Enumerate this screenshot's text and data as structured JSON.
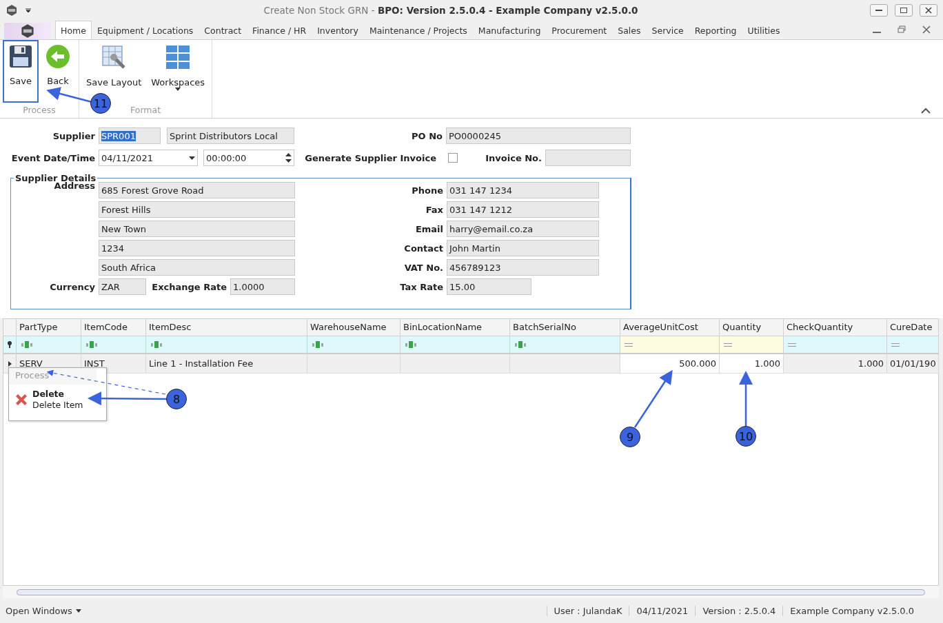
{
  "window": {
    "title": "Create Non Stock GRN - **BPO: Version 2.5.0.4 - Example Company v2.5.0.0**"
  },
  "tabs": [
    {
      "label": "Home",
      "selected": true
    },
    {
      "label": "Equipment / Locations",
      "selected": false
    },
    {
      "label": "Contract",
      "selected": false
    },
    {
      "label": "Finance / HR",
      "selected": false
    },
    {
      "label": "Inventory",
      "selected": false
    },
    {
      "label": "Maintenance / Projects",
      "selected": false
    },
    {
      "label": "Manufacturing",
      "selected": false
    },
    {
      "label": "Procurement",
      "selected": false
    },
    {
      "label": "Sales",
      "selected": false
    },
    {
      "label": "Service",
      "selected": false
    },
    {
      "label": "Reporting",
      "selected": false
    },
    {
      "label": "Utilities",
      "selected": false
    }
  ],
  "ribbon": {
    "groups": [
      {
        "label": "Process",
        "buttons": [
          {
            "label": "Save",
            "kind": "save",
            "highlighted": true
          },
          {
            "label": "Back",
            "kind": "back",
            "highlighted": false
          }
        ]
      },
      {
        "label": "Format",
        "buttons": [
          {
            "label": "Save Layout",
            "kind": "layout",
            "highlighted": false
          },
          {
            "label": "Workspaces",
            "kind": "tiles",
            "highlighted": false,
            "dropdown": true
          }
        ]
      }
    ]
  },
  "form": {
    "supplier": {
      "label": "Supplier",
      "code": "SPR001",
      "name": "Sprint Distributors Local"
    },
    "po": {
      "label": "PO No",
      "value": "PO0000245"
    },
    "event": {
      "label": "Event Date/Time",
      "date": "04/11/2021",
      "time": "00:00:00"
    },
    "generate_invoice": {
      "label": "Generate Supplier Invoice",
      "checked": false
    },
    "invoice_no": {
      "label": "Invoice No."
    }
  },
  "supplier_details": {
    "title": "Supplier Details",
    "address_label": "Address",
    "address_lines": [
      "685 Forest Grove Road",
      "Forest Hills",
      "New Town",
      "1234",
      "South Africa"
    ],
    "contacts": [
      {
        "label": "Phone",
        "value": "031 147 1234"
      },
      {
        "label": "Fax",
        "value": "031 147 1212"
      },
      {
        "label": "Email",
        "value": "harry@email.co.za"
      },
      {
        "label": "Contact",
        "value": "John Martin"
      },
      {
        "label": "VAT No.",
        "value": "456789123"
      }
    ],
    "currency": {
      "label": "Currency",
      "value": "ZAR"
    },
    "exchange_rate": {
      "label": "Exchange Rate",
      "value": "1.0000"
    },
    "tax_rate": {
      "label": "Tax Rate",
      "value": "15.00"
    }
  },
  "grid": {
    "columns": [
      {
        "label": "PartType",
        "kind": "text",
        "editable": false
      },
      {
        "label": "ItemCode",
        "kind": "text",
        "editable": false
      },
      {
        "label": "ItemDesc",
        "kind": "text",
        "editable": false
      },
      {
        "label": "WarehouseName",
        "kind": "text",
        "editable": false
      },
      {
        "label": "BinLocationName",
        "kind": "text",
        "editable": false
      },
      {
        "label": "BatchSerialNo",
        "kind": "text",
        "editable": false
      },
      {
        "label": "AverageUnitCost",
        "kind": "number",
        "editable": true
      },
      {
        "label": "Quantity",
        "kind": "number",
        "editable": true
      },
      {
        "label": "CheckQuantity",
        "kind": "number",
        "editable": false
      },
      {
        "label": "CureDate",
        "kind": "number",
        "editable": false
      }
    ],
    "rows": [
      {
        "cells": [
          "SERV",
          "INST",
          "Line 1 - Installation Fee",
          null,
          null,
          null,
          "500.000",
          "1.000",
          "1.000",
          "01/01/190"
        ]
      }
    ]
  },
  "context_menu": {
    "group": "Process",
    "items": [
      {
        "title": "Delete",
        "subtitle": "Delete Item"
      }
    ]
  },
  "callouts": [
    {
      "label": "11"
    },
    {
      "label": "8"
    },
    {
      "label": "9"
    },
    {
      "label": "10"
    }
  ],
  "status_bar": {
    "open_windows": "Open Windows",
    "items": [
      "User : JulandaK",
      "04/11/2021",
      "Version : 2.5.0.4",
      "Example Company v2.5.0.0"
    ]
  }
}
